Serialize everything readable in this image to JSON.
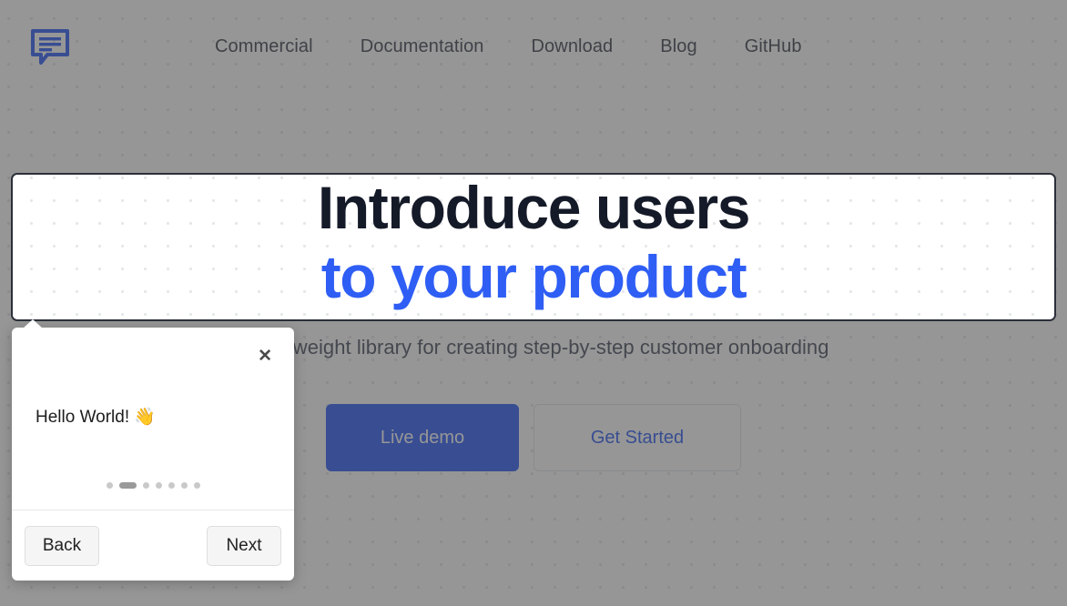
{
  "brand": {
    "logo_icon": "speech-bubble-icon",
    "accent_color": "#2f5ef5"
  },
  "nav": {
    "items": [
      {
        "label": "Commercial"
      },
      {
        "label": "Documentation"
      },
      {
        "label": "Download"
      },
      {
        "label": "Blog"
      },
      {
        "label": "GitHub"
      }
    ]
  },
  "hero": {
    "headline_line1": "Introduce users",
    "headline_line2": "to your product",
    "subtitle": "A lightweight library for creating step-by-step customer onboarding",
    "cta_primary": "Live demo",
    "cta_secondary": "Get Started"
  },
  "popover": {
    "close_icon": "✕",
    "text": "Hello World! 👋",
    "back_label": "Back",
    "next_label": "Next",
    "step_count": 7,
    "active_step": 2
  }
}
